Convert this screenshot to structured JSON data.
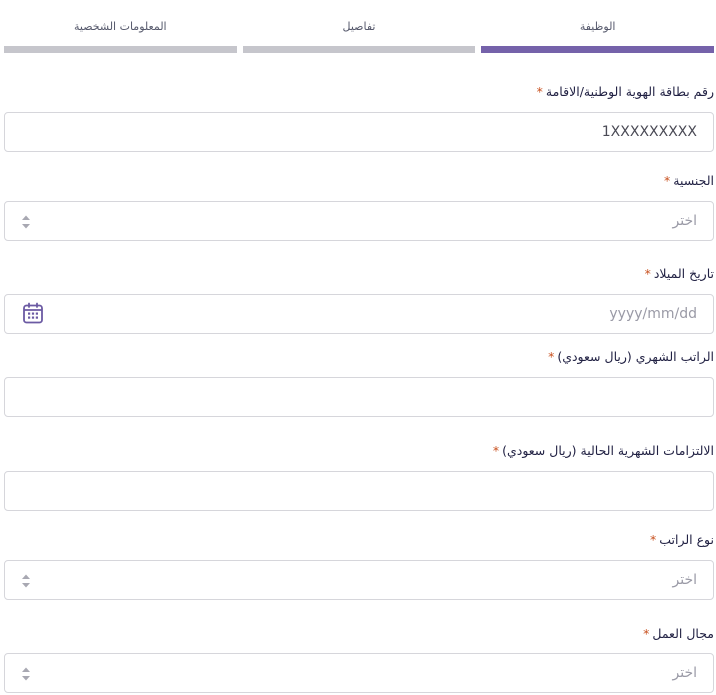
{
  "steps": [
    {
      "label": "الوظيفة",
      "active": true
    },
    {
      "label": "تفاصيل",
      "active": false
    },
    {
      "label": "المعلومات الشخصية",
      "active": false
    }
  ],
  "required_mark": "*",
  "form": {
    "id_number": {
      "label": "رقم بطاقة الهوية الوطنية/الاقامة",
      "value": "1XXXXXXXXX"
    },
    "nationality": {
      "label": "الجنسية",
      "placeholder": "اختر"
    },
    "birth_date": {
      "label": "تاريخ الميلاد",
      "placeholder": "yyyy/mm/dd",
      "icon": "calendar-icon"
    },
    "monthly_salary": {
      "label": "الراتب الشهري (ريال سعودي)",
      "value": ""
    },
    "monthly_obligations": {
      "label": "الالتزامات الشهرية الحالية (ريال سعودي)",
      "value": ""
    },
    "salary_type": {
      "label": "نوع الراتب",
      "placeholder": "اختر"
    },
    "work_field": {
      "label": "مجال العمل",
      "placeholder": "اختر"
    }
  },
  "colors": {
    "accent": "#7562aa",
    "step_inactive": "#c6c6cc",
    "required": "#c8501e",
    "border": "#d6d6db"
  }
}
